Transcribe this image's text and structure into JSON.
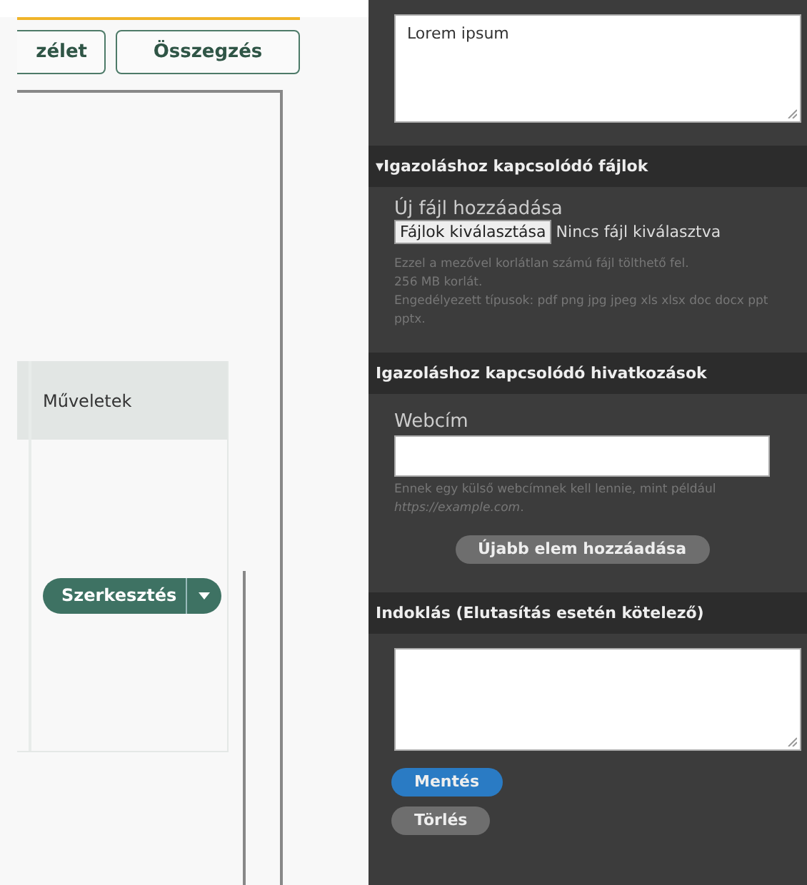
{
  "tabs": [
    {
      "label": "zélet",
      "selected": false
    },
    {
      "label": "Összegzés",
      "selected": false
    }
  ],
  "table": {
    "columns": [
      "Műveletek"
    ],
    "rows": [
      {
        "action": "Szerkesztés"
      }
    ]
  },
  "panel": {
    "top_textarea": {
      "value": "Lorem ipsum"
    },
    "files": {
      "title": "Igazoláshoz kapcsolódó fájlok",
      "toggle": "▾",
      "expanded": true,
      "label": "Új fájl hozzáadása",
      "choose_button": "Fájlok kiválasztása",
      "status": "Nincs fájl kiválasztva",
      "help": [
        "Ezzel a mezővel korlátlan számú fájl tölthető fel.",
        "256 MB korlát.",
        "Engedélyezett típusok: pdf png jpg jpeg xls xlsx doc docx ppt pptx."
      ]
    },
    "links": {
      "title": "Igazoláshoz kapcsolódó hivatkozások",
      "label": "Webcím",
      "help": "Ennek egy külső webcímnek kell lennie, mint például *https://example.com*.",
      "add_button": "Újabb elem hozzáadása"
    },
    "reason": {
      "title": "Indoklás (Elutasítás esetén kötelező)"
    },
    "buttons": [
      {
        "label": "Mentés",
        "kind": "primary"
      },
      {
        "label": "Törlés",
        "kind": "secondary"
      }
    ]
  }
}
